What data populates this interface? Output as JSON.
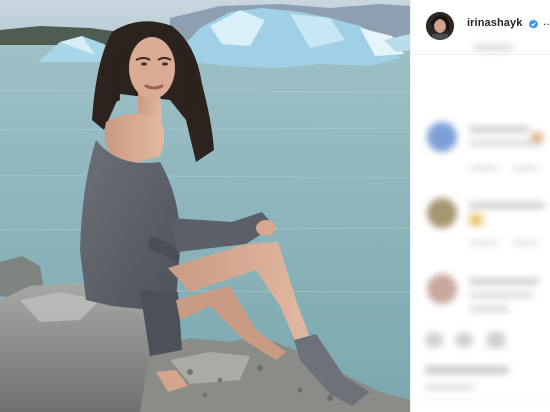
{
  "post": {
    "username": "irinashayk",
    "verified": true,
    "more_label": "..",
    "verified_icon": "verified-badge-icon",
    "more_icon": "ellipsis-icon"
  },
  "colors": {
    "verified_blue": "#3897f0",
    "username": "#262626",
    "divider": "#efefef"
  }
}
